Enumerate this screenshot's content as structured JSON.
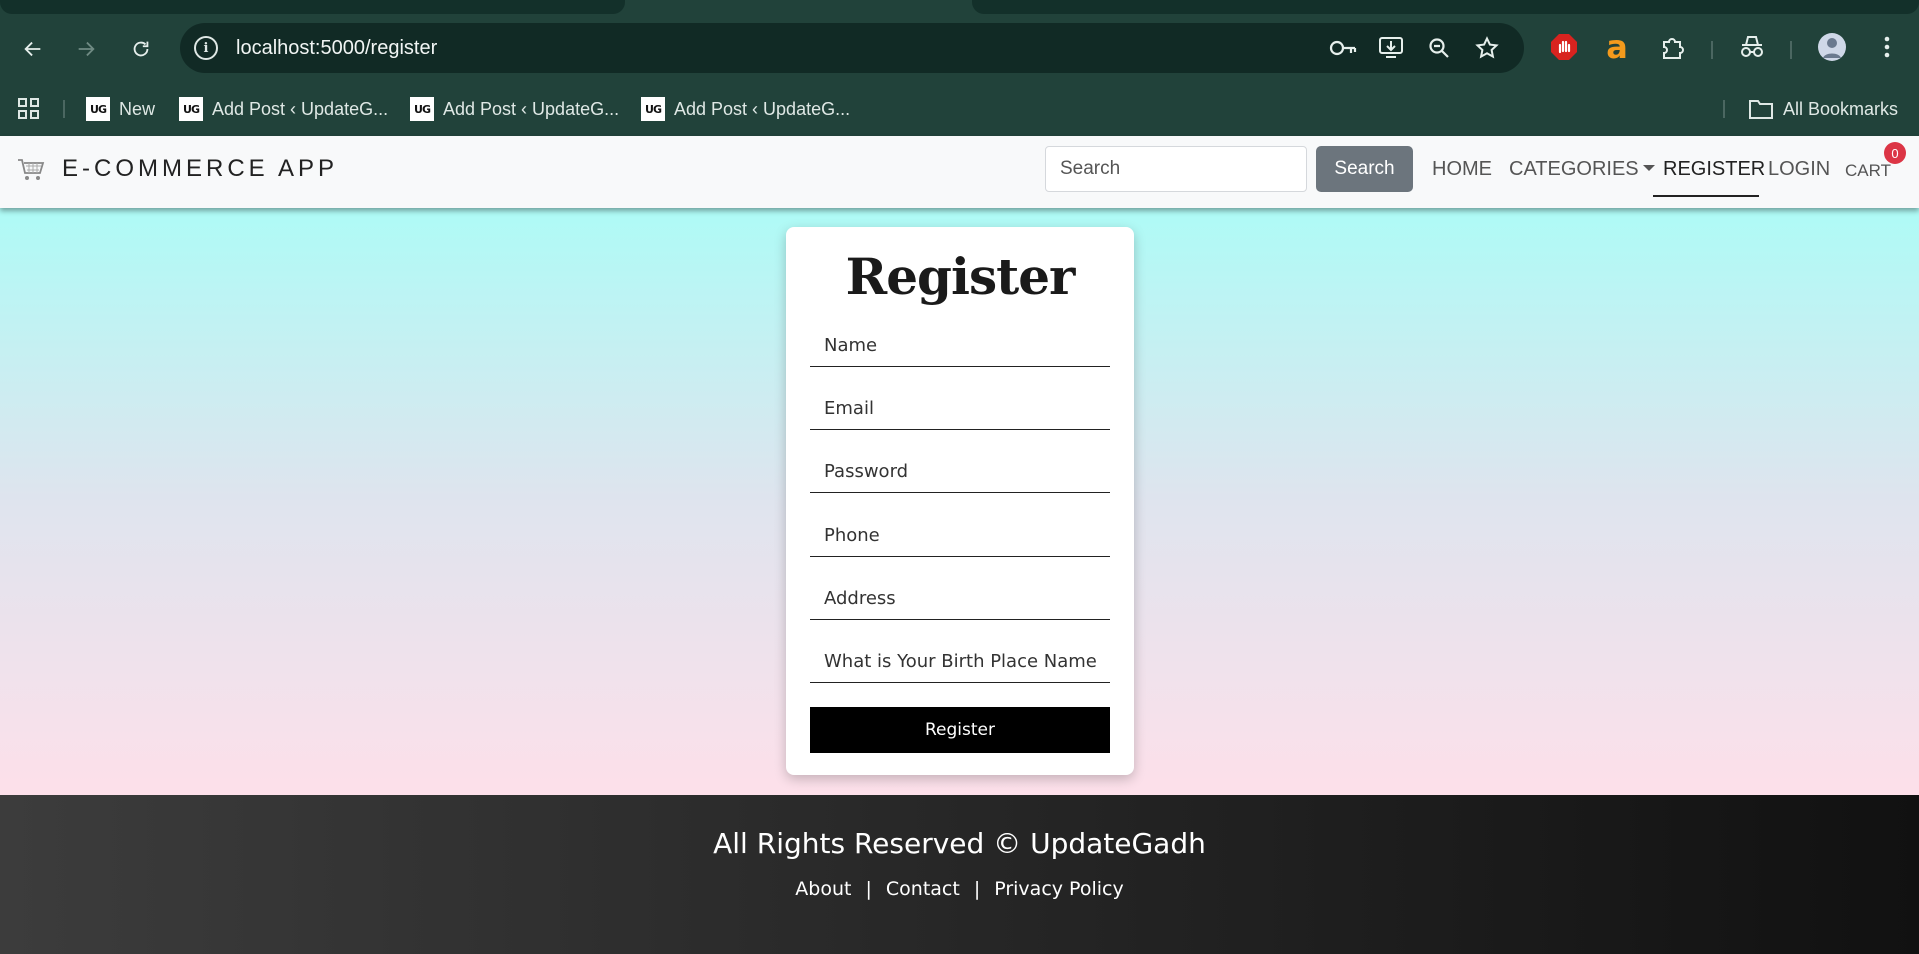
{
  "browser": {
    "url": "localhost:5000/register",
    "bookmarks": [
      {
        "label": "New",
        "favicon": "UG"
      },
      {
        "label": "Add Post ‹ UpdateG...",
        "favicon": "UG"
      },
      {
        "label": "Add Post ‹ UpdateG...",
        "favicon": "UG"
      },
      {
        "label": "Add Post ‹ UpdateG...",
        "favicon": "UG"
      }
    ],
    "all_bookmarks": "All Bookmarks",
    "icons": [
      "back-arrow-icon",
      "forward-arrow-icon",
      "reload-icon",
      "site-info-icon",
      "key-icon",
      "install-icon",
      "zoom-icon",
      "star-icon",
      "adblock-icon",
      "amazon-icon",
      "extensions-icon",
      "incognito-icon",
      "profile-avatar",
      "menu-icon",
      "apps-grid-icon",
      "folder-icon"
    ]
  },
  "navbar": {
    "brand": "E-COMMERCE APP",
    "search_placeholder": "Search",
    "search_button": "Search",
    "links": {
      "home": "HOME",
      "categories": "CATEGORIES",
      "register": "REGISTER",
      "login": "LOGIN",
      "cart": "CART"
    },
    "cart_count": "0"
  },
  "form": {
    "title": "Register",
    "fields": {
      "name": "Name",
      "email": "Email",
      "password": "Password",
      "phone": "Phone",
      "address": "Address",
      "answer": "What is Your Birth Place Name"
    },
    "submit": "Register"
  },
  "footer": {
    "copyright": "All Rights Reserved © UpdateGadh",
    "links": {
      "about": "About",
      "contact": "Contact",
      "privacy": "Privacy Policy"
    },
    "separator": "|"
  },
  "colors": {
    "chrome": "#21423a",
    "omnibox": "#112a25",
    "search_button": "#6c757d",
    "cart_badge": "#dc3545",
    "gradient_top": "#aefbf6",
    "gradient_bottom": "#fde0ea"
  }
}
